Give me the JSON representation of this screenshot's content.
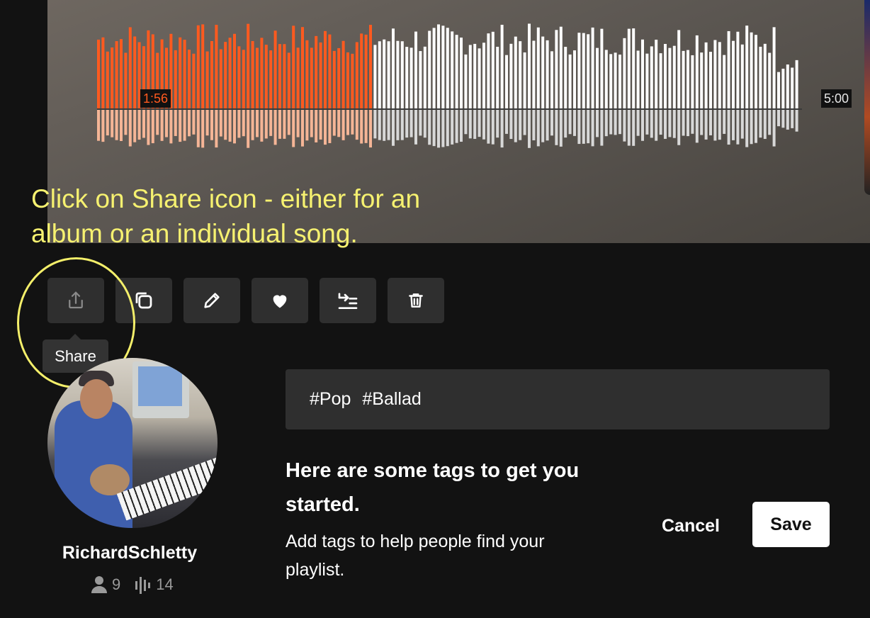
{
  "player": {
    "current_time": "1:56",
    "total_time": "5:00",
    "progress": 0.387,
    "played_color": "#ff5a1f",
    "played_reflection_color": "#f5b596",
    "unplayed_color": "#ffffff",
    "unplayed_reflection_color": "#d8d8d8"
  },
  "annotation": {
    "text": "Click on Share icon - either for an album or an individual song.",
    "color": "#f6f170"
  },
  "actions": [
    {
      "name": "share",
      "icon": "share-icon",
      "tooltip": "Share"
    },
    {
      "name": "duplicate",
      "icon": "copy-icon"
    },
    {
      "name": "edit",
      "icon": "pencil-icon"
    },
    {
      "name": "like",
      "icon": "heart-icon"
    },
    {
      "name": "add-to-queue",
      "icon": "queue-icon"
    },
    {
      "name": "delete",
      "icon": "trash-icon"
    }
  ],
  "tooltip": {
    "label": "Share"
  },
  "user": {
    "username": "RichardSchletty",
    "followers": "9",
    "tracks": "14"
  },
  "tags": {
    "items": [
      "#Pop",
      "#Ballad"
    ]
  },
  "hint": {
    "title": "Here are some tags to get you started.",
    "description": "Add tags to help people find your playlist."
  },
  "buttons": {
    "cancel": "Cancel",
    "save": "Save"
  }
}
